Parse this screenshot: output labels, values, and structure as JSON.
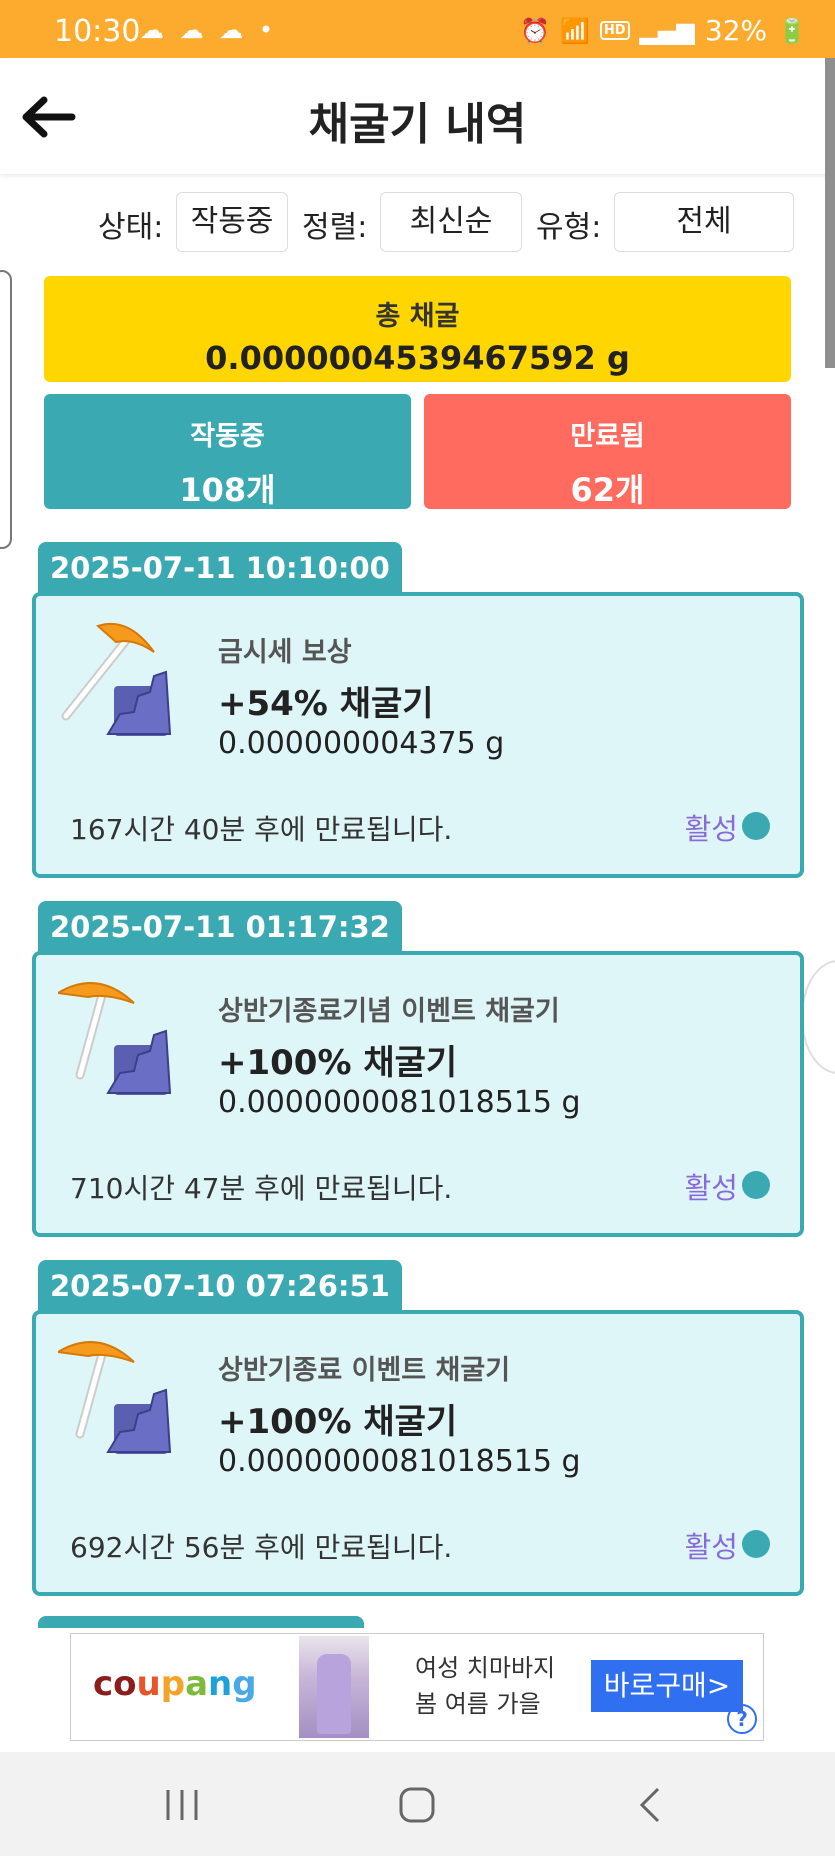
{
  "status_bar": {
    "time": "10:30",
    "battery": "32%"
  },
  "header": {
    "title": "채굴기 내역"
  },
  "filters": {
    "status_label": "상태:",
    "status_value": "작동중",
    "sort_label": "정렬:",
    "sort_value": "최신순",
    "type_label": "유형:",
    "type_value": "전체"
  },
  "summary": {
    "total_label": "총 채굴",
    "total_value": "0.0000004539467592 g",
    "active_label": "작동중",
    "active_count": "108개",
    "expired_label": "만료됨",
    "expired_count": "62개"
  },
  "miners": [
    {
      "date": "2025-07-11 10:10:00",
      "title": "금시세 보상",
      "boost": "+54% 채굴기",
      "amount": "0.000000004375 g",
      "expire": "167시간 40분 후에 만료됩니다.",
      "status": "활성"
    },
    {
      "date": "2025-07-11 01:17:32",
      "title": "상반기종료기념 이벤트 채굴기",
      "boost": "+100% 채굴기",
      "amount": "0.0000000081018515 g",
      "expire": "710시간 47분 후에 만료됩니다.",
      "status": "활성"
    },
    {
      "date": "2025-07-10 07:26:51",
      "title": "상반기종료 이벤트 채굴기",
      "boost": "+100% 채굴기",
      "amount": "0.0000000081018515 g",
      "expire": "692시간 56분 후에 만료됩니다.",
      "status": "활성"
    }
  ],
  "ad": {
    "logo_c": "c",
    "logo_o": "o",
    "logo_u": "u",
    "logo_p": "p",
    "logo_a": "a",
    "logo_n": "n",
    "logo_g": "g",
    "line1": "여성 치마바지",
    "line2": "봄 여름 가을",
    "button": "바로구매>",
    "help": "?"
  },
  "colors": {
    "status_bar": "#fdab2e",
    "total_bg": "#ffd600",
    "active_bg": "#3aa9b1",
    "expired_bg": "#ff6b5e",
    "card_bg": "#dff6f8",
    "status_text": "#8a6ad8"
  },
  "icons": [
    "back-arrow-icon",
    "pickaxe-icon",
    "ore-rock-icon",
    "active-dot-icon",
    "recent-apps-icon",
    "home-icon",
    "back-nav-icon"
  ]
}
